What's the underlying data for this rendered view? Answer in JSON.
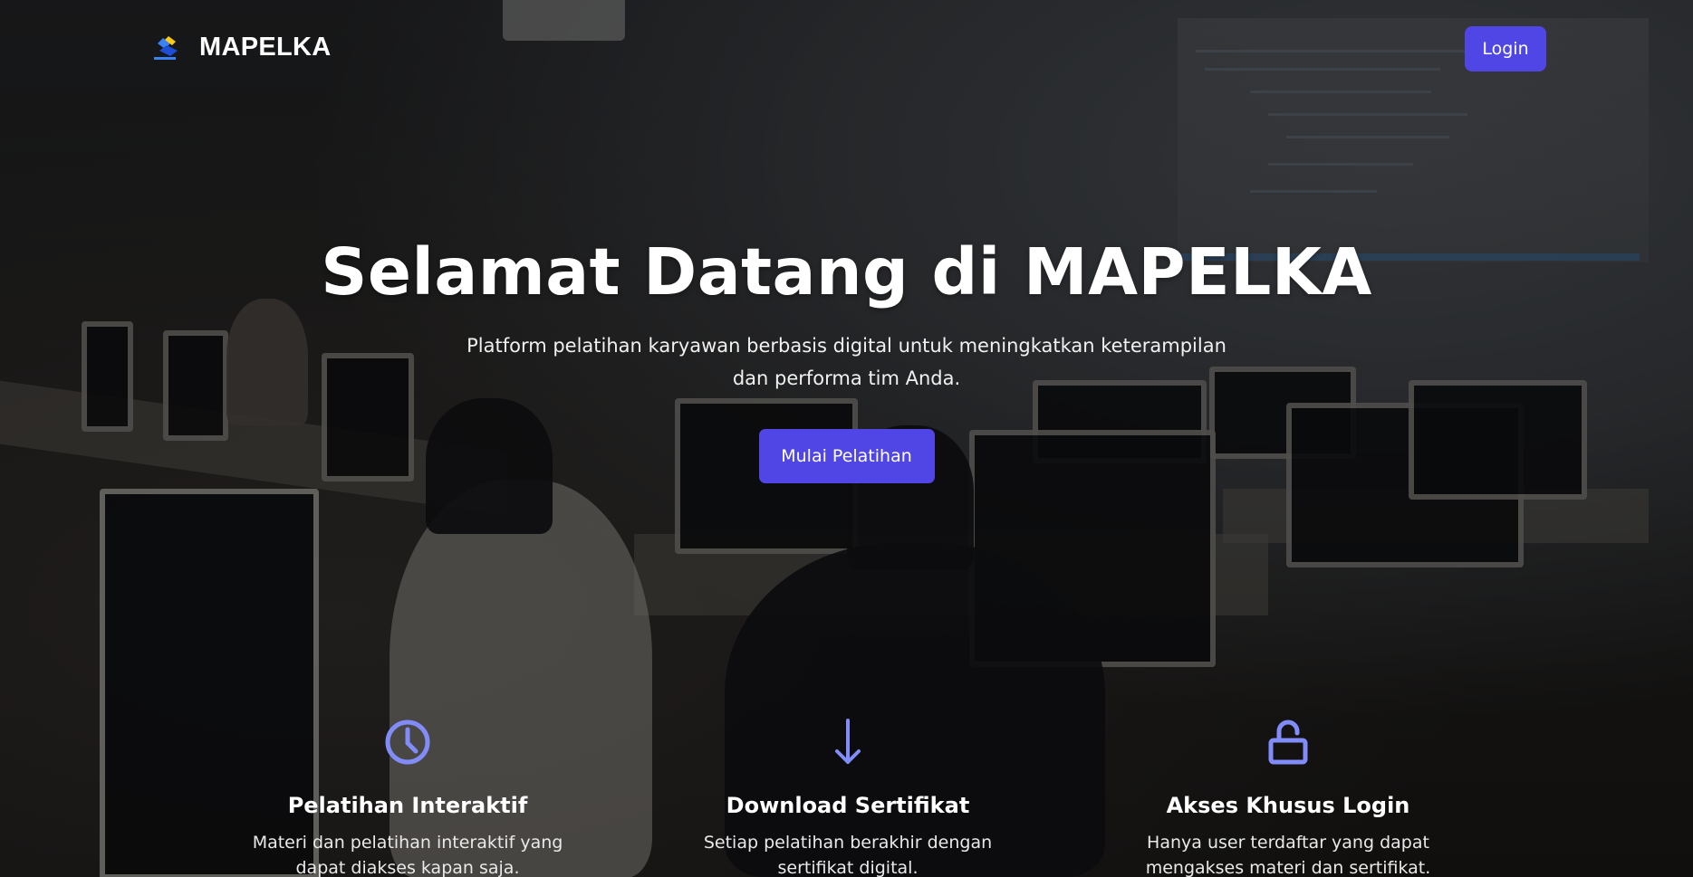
{
  "navbar": {
    "brand_name": "MAPELKA",
    "logo_icon": "mapelka-logo",
    "login_label": "Login"
  },
  "hero": {
    "title": "Selamat Datang di MAPELKA",
    "subtitle": "Platform pelatihan karyawan berbasis digital untuk meningkatkan keterampilan dan performa tim Anda.",
    "cta_label": "Mulai Pelatihan"
  },
  "features": [
    {
      "icon": "clock-icon",
      "title": "Pelatihan Interaktif",
      "description": "Materi dan pelatihan interaktif yang dapat diakses kapan saja."
    },
    {
      "icon": "download-arrow-icon",
      "title": "Download Sertifikat",
      "description": "Setiap pelatihan berakhir dengan sertifikat digital."
    },
    {
      "icon": "unlock-icon",
      "title": "Akses Khusus Login",
      "description": "Hanya user terdaftar yang dapat mengakses materi dan sertifikat."
    }
  ],
  "colors": {
    "primary": "#4f46e5",
    "icon": "#818cf8",
    "text": "#ffffff"
  }
}
